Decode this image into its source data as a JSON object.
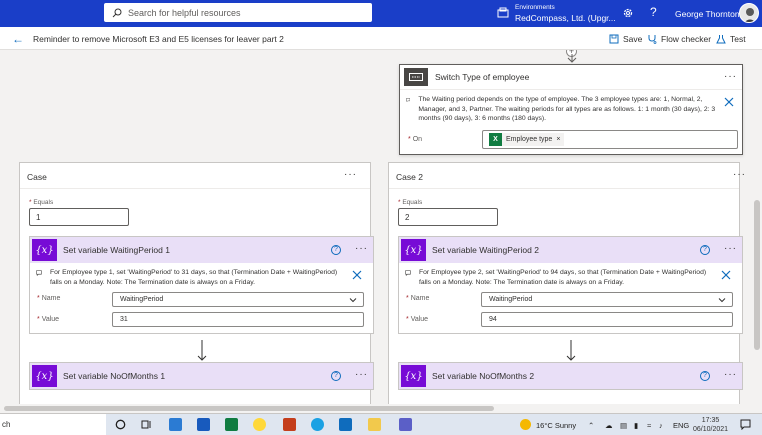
{
  "header": {
    "search_placeholder": "Search for helpful resources",
    "env_label": "Environments",
    "env_name": "RedCompass, Ltd. (Upgr...",
    "user_name": "George Thornton"
  },
  "commandbar": {
    "flow_title": "Reminder to remove Microsoft E3 and E5 licenses for leaver part 2",
    "save_label": "Save",
    "flow_checker_label": "Flow checker",
    "test_label": "Test"
  },
  "switch": {
    "title": "Switch Type of employee",
    "note": "The Waiting period depends on the type of employee. The 3 employee types are: 1, Normal, 2, Manager, and 3, Partner. The waiting periods for all types are as follows. 1: 1 month (30 days), 2: 3 months (90 days), 3: 6 months (180 days).",
    "on_label": "On",
    "on_token": "Employee type"
  },
  "cases": [
    {
      "title": "Case",
      "equals_label": "Equals",
      "equals_value": "1",
      "action1": {
        "title": "Set variable WaitingPeriod 1",
        "note": "For Employee type 1, set 'WaitingPeriod' to 31 days, so that (Termination Date + WaitingPeriod) falls on a Monday. Note: The Termination date is always on a Friday.",
        "name_label": "Name",
        "name_value": "WaitingPeriod",
        "value_label": "Value",
        "value_value": "31"
      },
      "action2": {
        "title": "Set variable NoOfMonths 1"
      }
    },
    {
      "title": "Case 2",
      "equals_label": "Equals",
      "equals_value": "2",
      "action1": {
        "title": "Set variable WaitingPeriod 2",
        "note": "For Employee type 2, set 'WaitingPeriod' to 94 days, so that (Termination Date + WaitingPeriod) falls on a Monday. Note: The Termination date is always on a Friday.",
        "name_label": "Name",
        "name_value": "WaitingPeriod",
        "value_label": "Value",
        "value_value": "94"
      },
      "action2": {
        "title": "Set variable NoOfMonths 2"
      }
    }
  ],
  "taskbar": {
    "search_text": "ch",
    "weather": "16°C  Sunny",
    "lang": "ENG",
    "time": "17:35",
    "date": "06/10/2021"
  },
  "colors": {
    "header_blue": "#1a3ec8",
    "variable_purple": "#770bd6",
    "variable_header": "#e9dff7",
    "excel_green": "#107c41"
  }
}
